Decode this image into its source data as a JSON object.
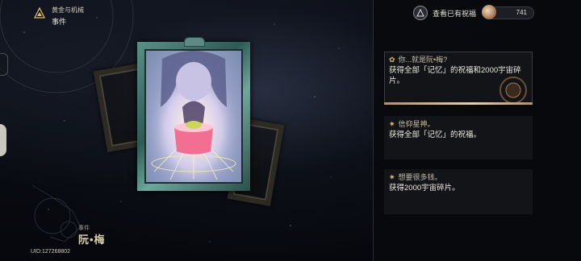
{
  "header": {
    "world": "黄金与机械",
    "section": "事件"
  },
  "event": {
    "type_label": "事件",
    "name": "阮•梅"
  },
  "uid": "UID:127268802",
  "topbar": {
    "view_blessings": "查看已有祝福",
    "currency_amount": "741"
  },
  "options": [
    {
      "title": "你...就是阮•梅?",
      "desc": "获得全部「记忆」的祝福和2000宇宙碎片。",
      "icon": "flower-icon",
      "selected": true
    },
    {
      "title": "信仰星神。",
      "desc": "获得全部「记忆」的祝福。",
      "icon": "star-icon",
      "selected": false
    },
    {
      "title": "想要很多钱。",
      "desc": "获得2000宇宙碎片。",
      "icon": "star-icon",
      "selected": false
    }
  ],
  "colors": {
    "accent_gold": "#d9b56d",
    "frame_teal": "#5a8f86",
    "panel_bg": "#141518"
  }
}
